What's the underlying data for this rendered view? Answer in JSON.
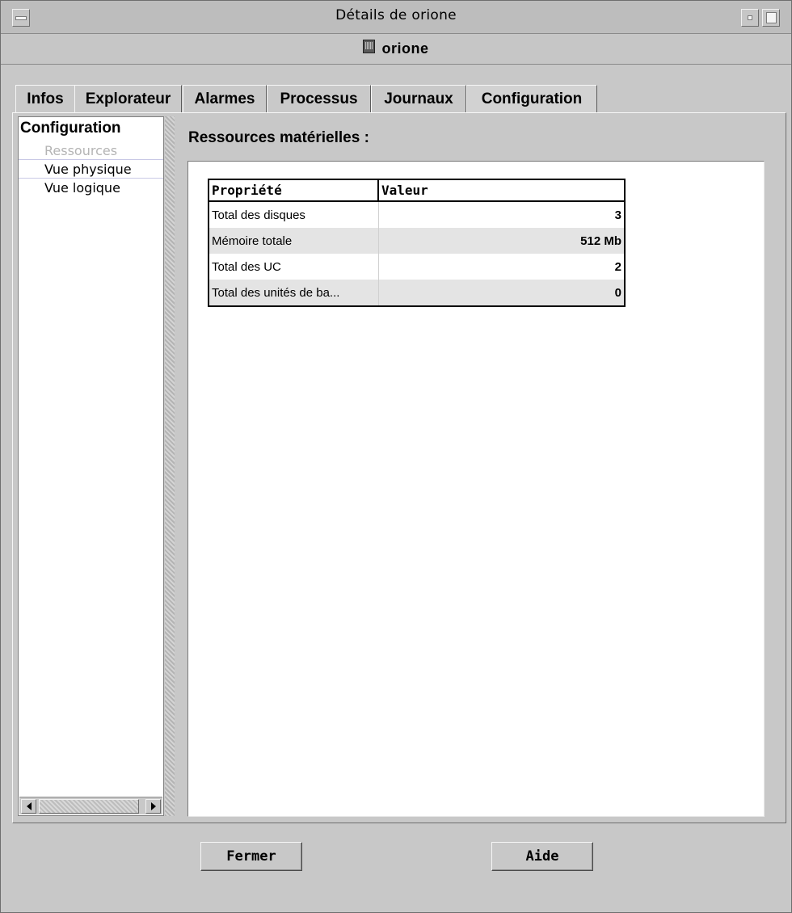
{
  "window": {
    "title": "Détails de orione"
  },
  "host": {
    "name": "orione",
    "icon": "host-icon"
  },
  "tabs": [
    {
      "label": "Infos"
    },
    {
      "label": "Explorateur"
    },
    {
      "label": "Alarmes"
    },
    {
      "label": "Processus"
    },
    {
      "label": "Journaux"
    },
    {
      "label": "Configuration",
      "active": true
    }
  ],
  "tree": {
    "root": "Configuration",
    "items": [
      {
        "label": "Ressources",
        "selected": true
      },
      {
        "label": "Vue physique"
      },
      {
        "label": "Vue logique"
      }
    ]
  },
  "content": {
    "title": "Ressources matérielles :",
    "table": {
      "headers": [
        "Propriété",
        "Valeur"
      ],
      "rows": [
        {
          "name": "Total des disques",
          "value": "3"
        },
        {
          "name": "Mémoire totale",
          "value": "512 Mb"
        },
        {
          "name": "Total des UC",
          "value": "2"
        },
        {
          "name": "Total des unités de ba...",
          "value": "0"
        }
      ]
    }
  },
  "buttons": {
    "close": "Fermer",
    "help": "Aide"
  }
}
